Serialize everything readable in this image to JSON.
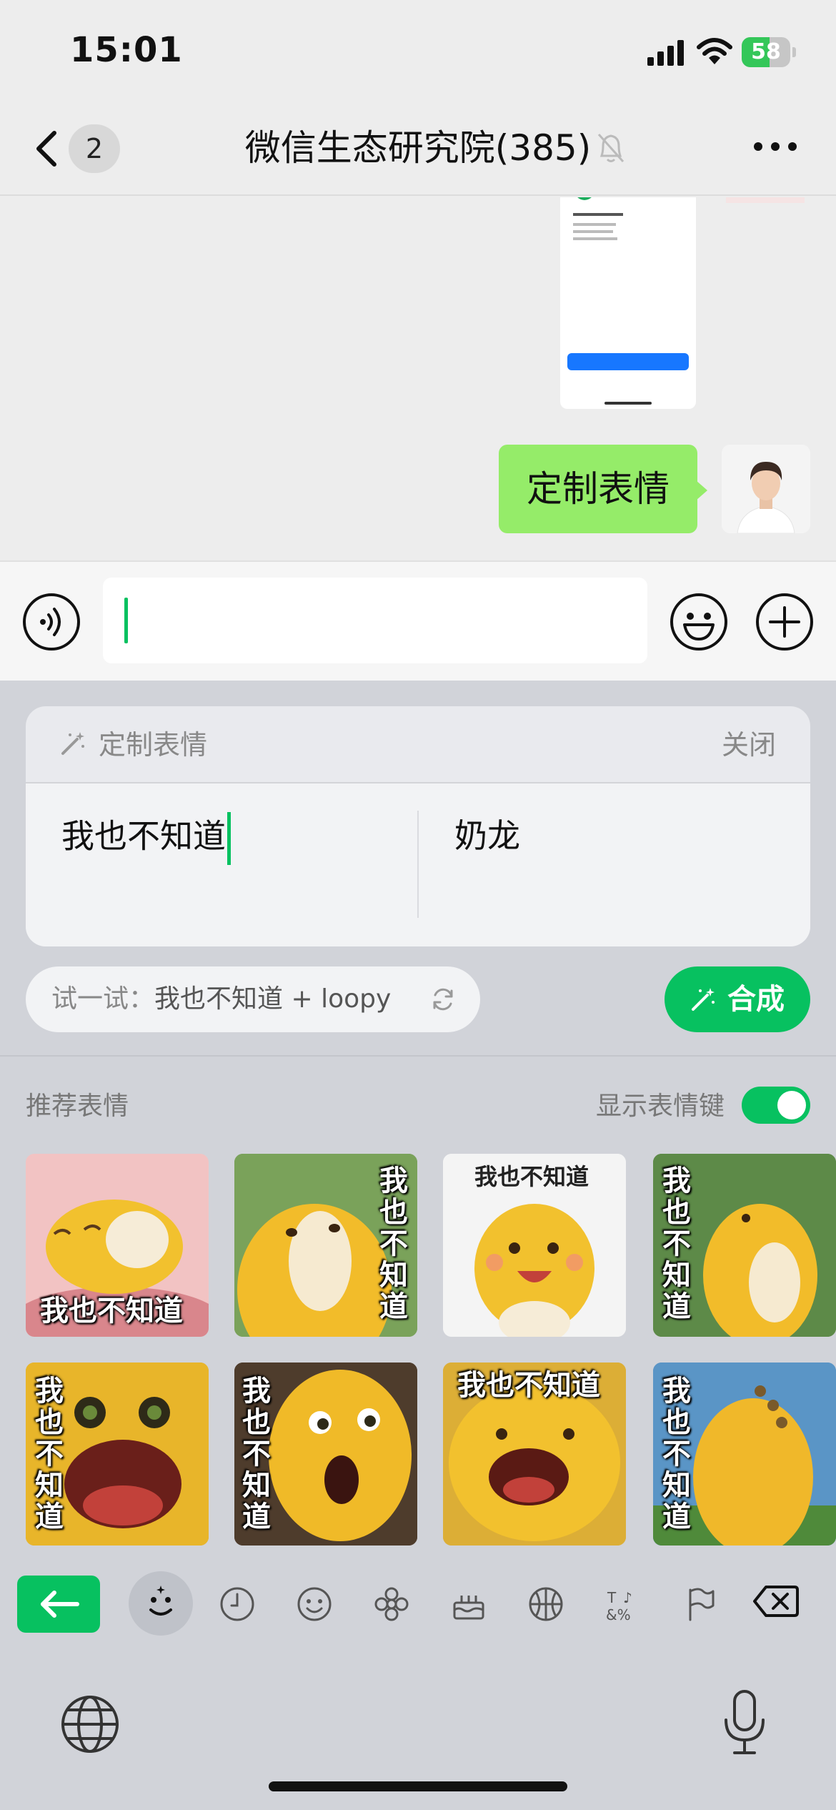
{
  "status_bar": {
    "time": "15:01",
    "battery_level": "58",
    "battery_percent": 58
  },
  "nav": {
    "unread_count": "2",
    "title": "微信生态研究院(385)"
  },
  "messages": {
    "sent_text": "定制表情"
  },
  "custom_sticker": {
    "header_title": "定制表情",
    "close_label": "关闭",
    "text_value": "我也不知道",
    "character_value": "奶龙",
    "suggestion_prefix": "试一试：",
    "suggestion_value": "我也不知道 + loopy",
    "compose_label": "合成"
  },
  "recommend": {
    "title": "推荐表情",
    "toggle_label": "显示表情键",
    "toggle_on": true,
    "stickers": [
      {
        "caption": "我也不知道"
      },
      {
        "caption": "我也不知道"
      },
      {
        "caption": "我也不知道"
      },
      {
        "caption": "我也不知道"
      },
      {
        "caption": "我也不知道"
      },
      {
        "caption": "我也不知道"
      },
      {
        "caption": "我也不知道"
      },
      {
        "caption": "我也不知道"
      }
    ]
  },
  "colors": {
    "accent": "#07c160",
    "bubble": "#95ec69",
    "panel": "#d1d3d9"
  },
  "category_icons": [
    "back-arrow-icon",
    "sticker-face-icon",
    "clock-icon",
    "smiley-icon",
    "flower-icon",
    "cake-icon",
    "ball-icon",
    "symbols-icon",
    "flag-icon",
    "delete-icon"
  ]
}
